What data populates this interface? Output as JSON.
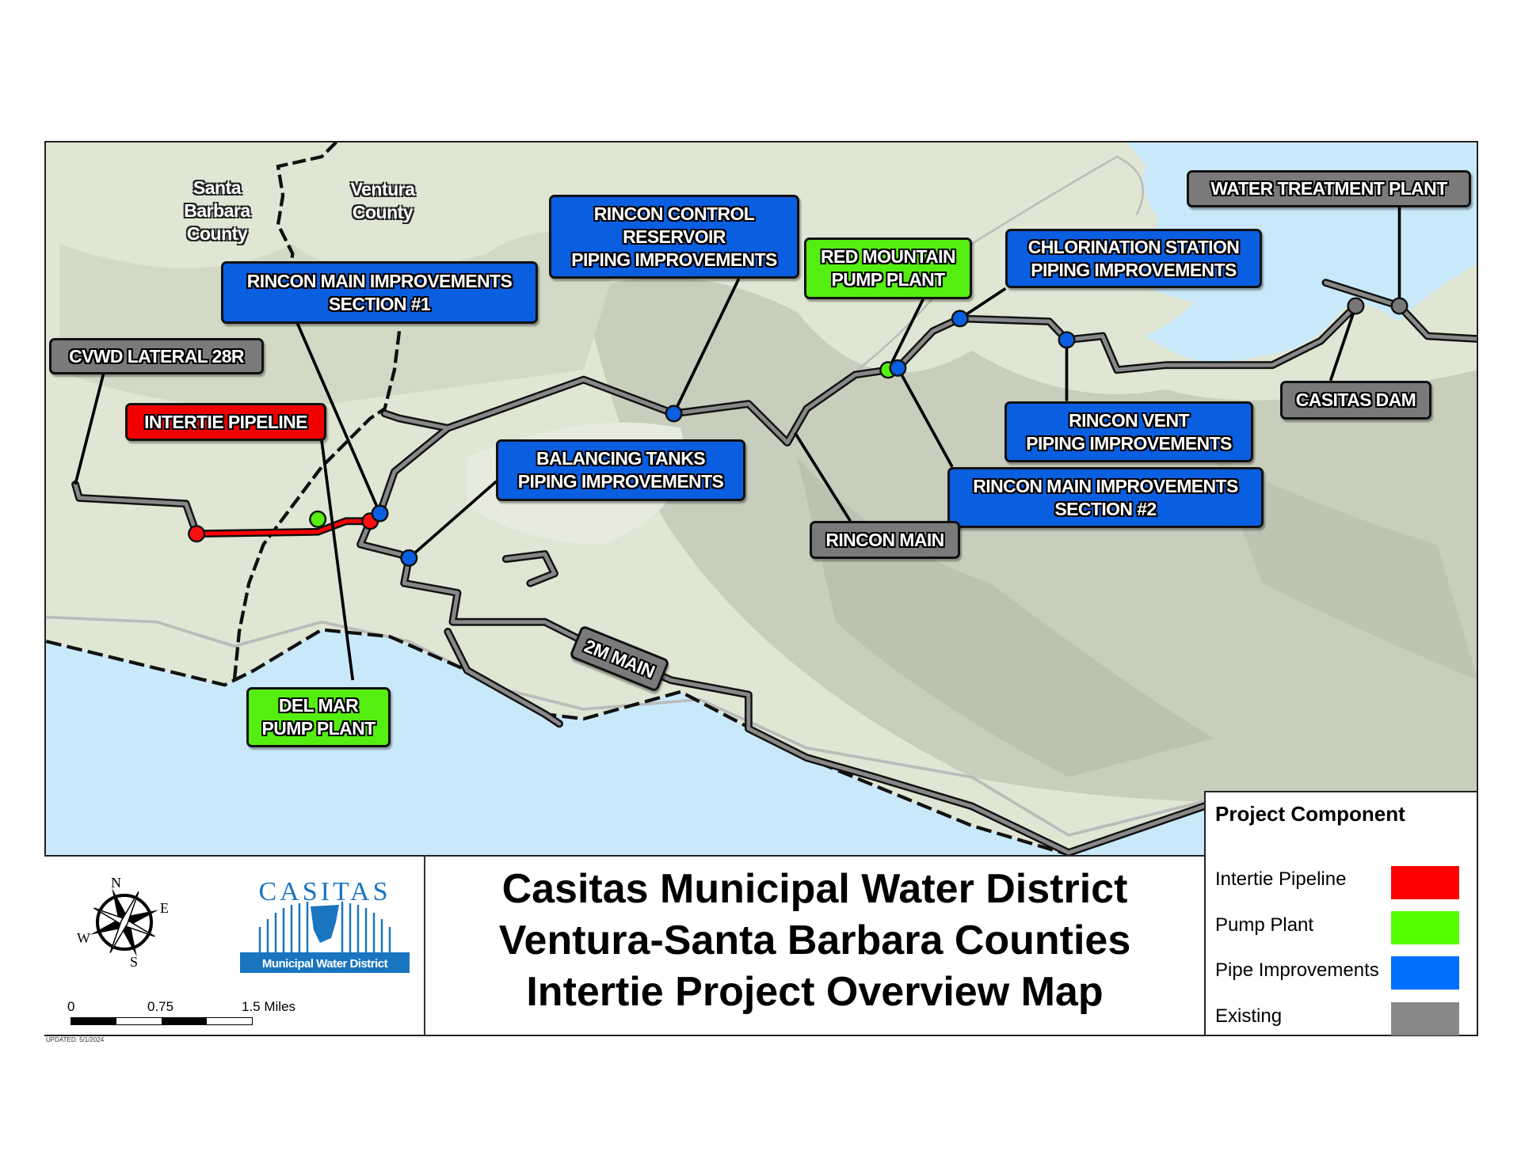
{
  "map": {
    "counties": [
      {
        "lines": [
          "Santa",
          "Barbara",
          "County"
        ]
      },
      {
        "lines": [
          "Ventura",
          "County"
        ]
      }
    ],
    "labels": {
      "cvwd_lateral": {
        "lines": [
          "CVWD LATERAL 28R"
        ],
        "category": "Existing"
      },
      "intertie_pipeline": {
        "lines": [
          "INTERTIE PIPELINE"
        ],
        "category": "Intertie Pipeline"
      },
      "rincon_main_sec1": {
        "lines": [
          "RINCON MAIN IMPROVEMENTS",
          "SECTION #1"
        ],
        "category": "Pipe Improvements"
      },
      "rincon_control": {
        "lines": [
          "RINCON CONTROL",
          "RESERVOIR",
          "PIPING IMPROVEMENTS"
        ],
        "category": "Pipe Improvements"
      },
      "red_mountain": {
        "lines": [
          "RED MOUNTAIN",
          "PUMP PLANT"
        ],
        "category": "Pump Plant"
      },
      "chlorination": {
        "lines": [
          "CHLORINATION STATION",
          "PIPING IMPROVEMENTS"
        ],
        "category": "Pipe Improvements"
      },
      "water_treatment": {
        "lines": [
          "WATER TREATMENT PLANT"
        ],
        "category": "Existing"
      },
      "casitas_dam": {
        "lines": [
          "CASITAS DAM"
        ],
        "category": "Existing"
      },
      "rincon_vent": {
        "lines": [
          "RINCON VENT",
          "PIPING IMPROVEMENTS"
        ],
        "category": "Pipe Improvements"
      },
      "rincon_main_sec2": {
        "lines": [
          "RINCON MAIN IMPROVEMENTS",
          "SECTION #2"
        ],
        "category": "Pipe Improvements"
      },
      "rincon_main": {
        "lines": [
          "RINCON MAIN"
        ],
        "category": "Existing"
      },
      "balancing_tanks": {
        "lines": [
          "BALANCING TANKS",
          "PIPING IMPROVEMENTS"
        ],
        "category": "Pipe Improvements"
      },
      "two_m_main": {
        "lines": [
          "2M MAIN"
        ],
        "category": "Existing"
      },
      "del_mar": {
        "lines": [
          "DEL MAR",
          "PUMP PLANT"
        ],
        "category": "Pump Plant"
      }
    }
  },
  "title": {
    "line1": "Casitas Municipal Water District",
    "line2": "Ventura-Santa Barbara Counties",
    "line3": "Intertie Project Overview Map"
  },
  "legend": {
    "title": "Project Component",
    "items": [
      {
        "label": "Intertie Pipeline",
        "color": "#ff0000"
      },
      {
        "label": "Pump Plant",
        "color": "#55ff00"
      },
      {
        "label": "Pipe Improvements",
        "color": "#0070ff"
      },
      {
        "label": "Existing",
        "color": "#888888"
      }
    ]
  },
  "logo": {
    "name": "CASITAS",
    "subtitle": "Municipal Water District",
    "color": "#1a75c0"
  },
  "compass": {
    "n": "N",
    "e": "E",
    "s": "S",
    "w": "W"
  },
  "scale_bar": {
    "labels": [
      "0",
      "0.75",
      "1.5 Miles"
    ]
  },
  "updated": "UPDATED: 5/1/2024",
  "colors": {
    "ocean": "#c9e9fb",
    "land": "#dfe6d3",
    "existing_pipe": "#777777",
    "intertie": "#ff0000",
    "pump": "#55ee11",
    "pipe_improvement": "#0a5ee0"
  }
}
